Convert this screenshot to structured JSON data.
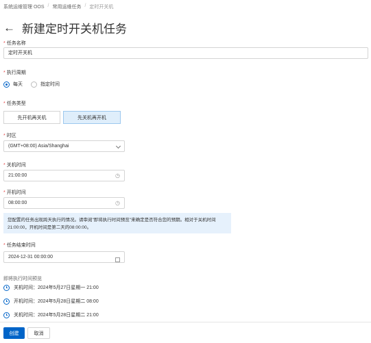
{
  "breadcrumb": [
    "系统运维管理 OOS",
    "常用运维任务",
    "定时开关机"
  ],
  "title": "新建定时开关机任务",
  "task_name": {
    "label": "任务名称",
    "value": "定时开关机"
  },
  "cycle": {
    "label": "执行周期",
    "options": [
      "每天",
      "指定时间"
    ],
    "selected": "每天"
  },
  "task_type": {
    "label": "任务类型",
    "options": [
      "先开机再关机",
      "先关机再开机"
    ],
    "selected": "先关机再开机"
  },
  "timezone": {
    "label": "时区",
    "value": "(GMT+08:00) Asia/Shanghai"
  },
  "shutdown_time": {
    "label": "关机时间",
    "value": "21:00:00"
  },
  "boot_time": {
    "label": "开机时间",
    "value": "08:00:00"
  },
  "notice": "您配置的任务出现跨天执行的情况。请审阅\"即将执行时间预览\"来确定是否符合您的预期。相对于关机时间21:00:00，开机时间是第二天的08:00:00。",
  "end_time": {
    "label": "任务结束时间",
    "value": "2024-12-31 00:00:00"
  },
  "preview": {
    "title": "即将执行时间预览",
    "items": [
      "关机时间：2024年5月27日星期一 21:00",
      "开机时间：2024年5月28日星期二 08:00",
      "关机时间：2024年5月28日星期二 21:00"
    ]
  },
  "footer": {
    "create": "创建",
    "cancel": "取消"
  },
  "colors": {
    "primary": "#0064c8",
    "required": "#e54545",
    "info_bg": "#e6f1fc"
  },
  "icons": {
    "back": "arrow-left-icon",
    "clock": "clock-icon",
    "calendar": "calendar-icon",
    "dropdown": "chevron-down-icon"
  }
}
